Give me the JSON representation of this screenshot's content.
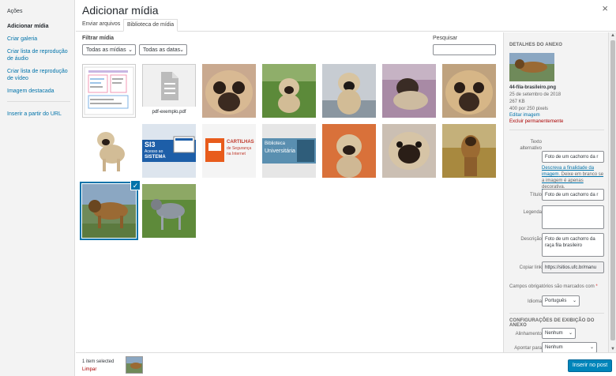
{
  "sidebar": {
    "title": "Ações",
    "items": [
      {
        "label": "Adicionar mídia"
      },
      {
        "label": "Criar galeria"
      },
      {
        "label": "Criar lista de reprodução de áudio"
      },
      {
        "label": "Criar lista de reprodução de vídeo"
      },
      {
        "label": "Imagem destacada"
      },
      {
        "label": "Inserir a partir do URL"
      }
    ]
  },
  "header": {
    "title": "Adicionar mídia",
    "close_icon": "×",
    "tabs": [
      {
        "label": "Enviar arquivos"
      },
      {
        "label": "Biblioteca de mídia"
      }
    ]
  },
  "toolbar": {
    "filter_label": "Filtrar mídia",
    "type_select": "Todas as mídias",
    "date_select": "Todas as datas",
    "search_label": "Pesquisar",
    "search_value": ""
  },
  "grid": {
    "pdf_name": "pdf-exemplo.pdf",
    "tile2_title": "SI3",
    "tile2_line1": "Acesso ao",
    "tile2_line2": "SISTEMA",
    "tile3_title": "CARTILHAS",
    "tile3_line1": "de Segurança",
    "tile3_line2": "na Internet",
    "tile4_line1": "Biblioteca",
    "tile4_line2": "Universitária"
  },
  "details": {
    "heading": "DETALHES DO ANEXO",
    "filename": "44-fila-brasileiro.png",
    "date": "25 de setembro de 2018",
    "size": "267 KB",
    "dimensions": "400 por 250 pixels",
    "edit_link": "Editar imagem",
    "delete_link": "Excluir permanentemente",
    "alt_label": "Texto alternativo",
    "alt_value": "Foto de um cachorro da r",
    "alt_help_link": "Descreva a finalidade da imagem",
    "alt_help_text": ". Deixe em branco se a imagem é apenas decorativa.",
    "title_label": "Título",
    "title_value": "Foto de um cachorro da r",
    "caption_label": "Legenda",
    "caption_value": "",
    "description_label": "Descrição",
    "description_value": "Foto de um cachorro da raça fila brasileiro",
    "copy_link_label": "Copiar link",
    "copy_link_value": "https://sitios.ufc.br/manu",
    "required_note": "Campos obrigatórios são marcados com",
    "required_star": "*",
    "language_label": "Idioma",
    "language_value": "Português",
    "display_heading": "CONFIGURAÇÕES DE EXIBIÇÃO DO ANEXO",
    "align_label": "Alinhamento",
    "align_value": "Nenhum",
    "link_to_label": "Apontar para",
    "link_to_value": "Nenhum"
  },
  "footer": {
    "selected_count": "1 item selected",
    "clear_link": "Limpar",
    "insert_button": "Inserir no post"
  },
  "colors": {
    "accent": "#0073aa",
    "button": "#0085ba",
    "danger": "#a00"
  }
}
